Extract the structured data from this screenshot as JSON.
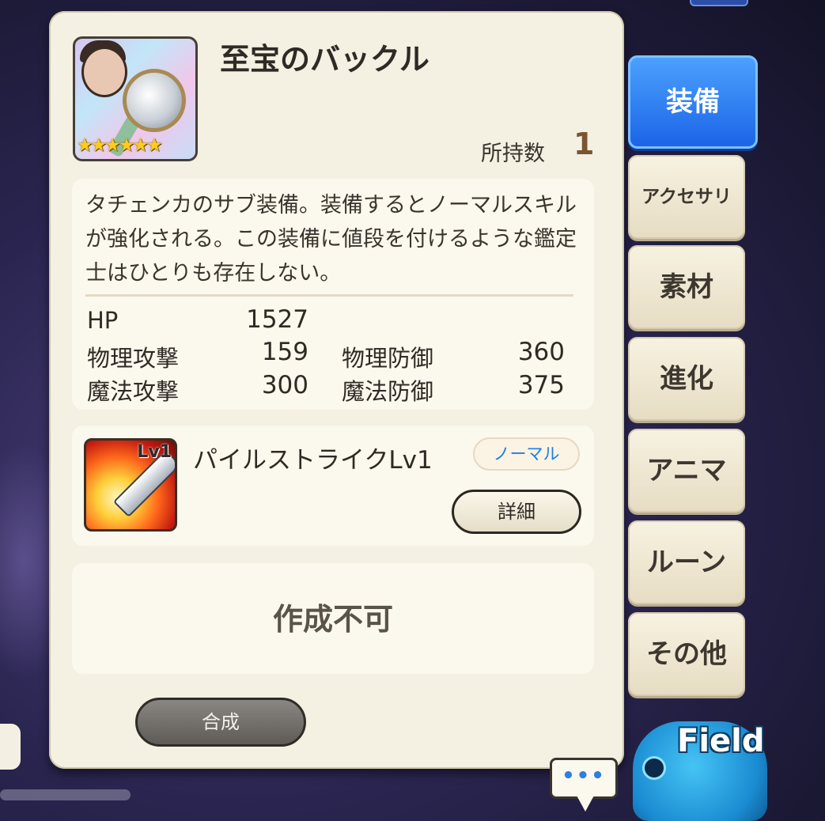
{
  "item": {
    "name": "至宝のバックル",
    "rarity_stars": "★★★★★★",
    "owned_label": "所持数",
    "owned_count": "1",
    "description": "タチェンカのサブ装備。装備するとノーマルスキルが強化される。この装備に値段を付けるような鑑定士はひとりも存在しない。"
  },
  "stats": [
    {
      "label": "HP",
      "value": "1527"
    },
    {
      "label": "物理攻撃",
      "value": "159"
    },
    {
      "label": "物理防御",
      "value": "360"
    },
    {
      "label": "魔法攻撃",
      "value": "300"
    },
    {
      "label": "魔法防御",
      "value": "375"
    }
  ],
  "skill": {
    "level_badge": "Lv1",
    "name": "パイルストライクLv1",
    "type_tag": "ノーマル",
    "detail_label": "詳細"
  },
  "status_text": "作成不可",
  "combine_label": "合成",
  "tabs": [
    {
      "label": "装備",
      "active": true
    },
    {
      "label": "アクセサリ",
      "active": false
    },
    {
      "label": "素材",
      "active": false
    },
    {
      "label": "進化",
      "active": false
    },
    {
      "label": "アニマ",
      "active": false
    },
    {
      "label": "ルーン",
      "active": false
    },
    {
      "label": "その他",
      "active": false
    }
  ],
  "chat_bubble": "•••",
  "field_button": "Field",
  "colors": {
    "panel_bg": "#f4f0e2",
    "active_tab": "#1a63e6",
    "tag_text": "#1f7fe0",
    "owned_count": "#7a5532"
  },
  "icons": [
    "buckle-item-icon",
    "skill-pile-strike-icon",
    "chat-bubble-icon",
    "field-mascot-icon"
  ]
}
